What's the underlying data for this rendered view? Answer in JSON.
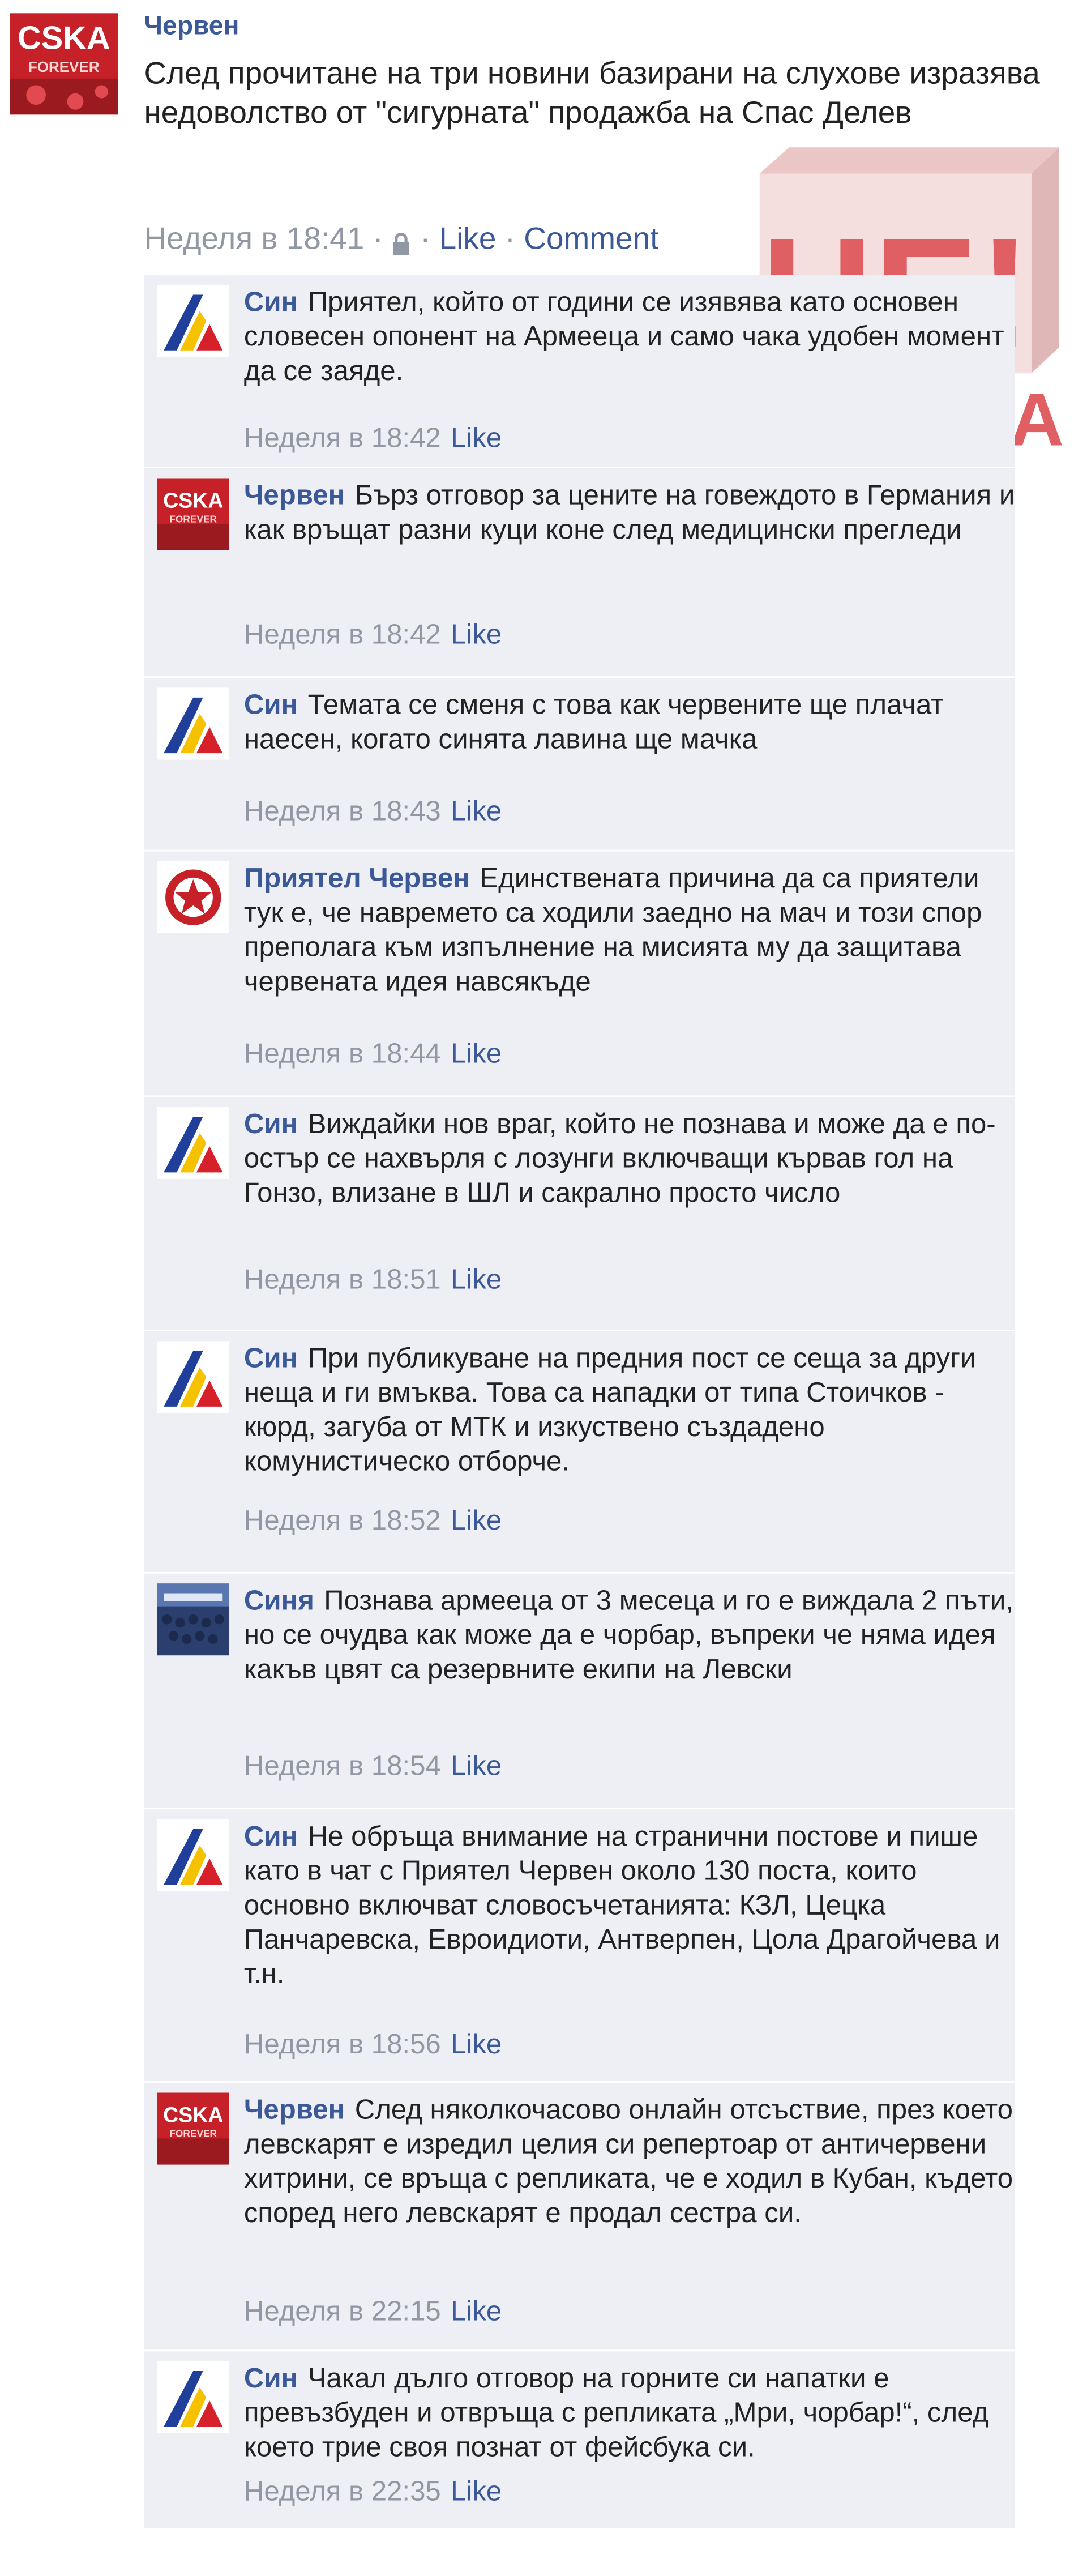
{
  "post": {
    "avatar_label": "CSKA",
    "avatar_sub": "FOREVER",
    "author": "Червен",
    "text": "След прочитане на три новини базирани на слухове изразява недоволство от \"сигурната\" продажба на Спас Делев",
    "time": "Неделя в 18:41",
    "privacy_icon": "lock-icon",
    "like": "Like",
    "comment": "Comment"
  },
  "watermark": {
    "top": "НЕ!",
    "bottom": "ЗАСАДА"
  },
  "comments": [
    {
      "avatar": "levski",
      "author": "Син",
      "text": "Приятел, който от години се изявява като основен словесен опонент на Армееца и само чака удобен момент да се заяде.",
      "time": "Неделя в 18:42",
      "like": "Like"
    },
    {
      "avatar": "cska",
      "author": "Червен",
      "text": "Бърз отговор за цените на говеждото в Германия и как връщат разни куци коне след медицински прегледи",
      "time": "Неделя в 18:42",
      "like": "Like"
    },
    {
      "avatar": "levski",
      "author": "Син",
      "text": "Темата се сменя с това как червените ще плачат наесен, когато синята лавина ще мачка",
      "time": "Неделя в 18:43",
      "like": "Like"
    },
    {
      "avatar": "star",
      "author": "Приятел Червен",
      "text": "Единствената причина да са приятели тук е, че навремето са ходили заедно на мач и този спор преполага към изпълнение на мисията му да защитава червената идея навсякъде",
      "time": "Неделя в 18:44",
      "like": "Like"
    },
    {
      "avatar": "levski",
      "author": "Син",
      "text": "Виждайки нов враг, който не познава и може да е по-остър се нахвърля с лозунги включващи кървав гол на Гонзо, влизане в ШЛ и сакрално просто число",
      "time": "Неделя в 18:51",
      "like": "Like"
    },
    {
      "avatar": "levski",
      "author": "Син",
      "text": "При публикуване на предния пост се сеща за други неща и ги вмъква. Това са нападки от типа Стоичков - кюрд, загуба от МТК и изкуствено създадено комунистическо отборче.",
      "time": "Неделя в 18:52",
      "like": "Like"
    },
    {
      "avatar": "crowd",
      "author": "Синя",
      "text": "Познава армееца от 3 месеца и го е виждала 2 пъти, но се очудва как може да е чорбар, въпреки че няма идея какъв цвят са резервните екипи на Левски",
      "time": "Неделя в 18:54",
      "like": "Like"
    },
    {
      "avatar": "levski",
      "author": "Син",
      "text": "Не обръща внимание на странични постове и пише като в чат с Приятел Червен около 130 поста, които основно включват словосъчетанията: КЗЛ, Цецка Панчаревска, Евроидиоти, Антверпен, Цола Драгойчева и т.н.",
      "time": "Неделя в 18:56",
      "like": "Like"
    },
    {
      "avatar": "cska",
      "author": "Червен",
      "text": "След няколкочасово онлайн отсъствие, през което левскарят е изредил целия си репертоар от античервени хитрини, се връща с репликата, че е ходил в Кубан, където според него левскарят е продал сестра си.",
      "time": "Неделя в 22:15",
      "like": "Like"
    },
    {
      "avatar": "levski",
      "author": "Син",
      "text": "Чакал дълго отговор на горните си напатки е превъзбуден и отвръща с репликата „Мри, чорбар!“, след което трие своя познат от фейсбука си.",
      "time": "Неделя в 22:35",
      "like": "Like"
    }
  ],
  "colors": {
    "link": "#3b5998",
    "meta": "#9197a3",
    "comment_bg": "#edeff4",
    "levski_blue": "#1f3f9a",
    "levski_yellow": "#f6c200",
    "levski_red": "#d6202a",
    "cska_red": "#cc1f27"
  }
}
